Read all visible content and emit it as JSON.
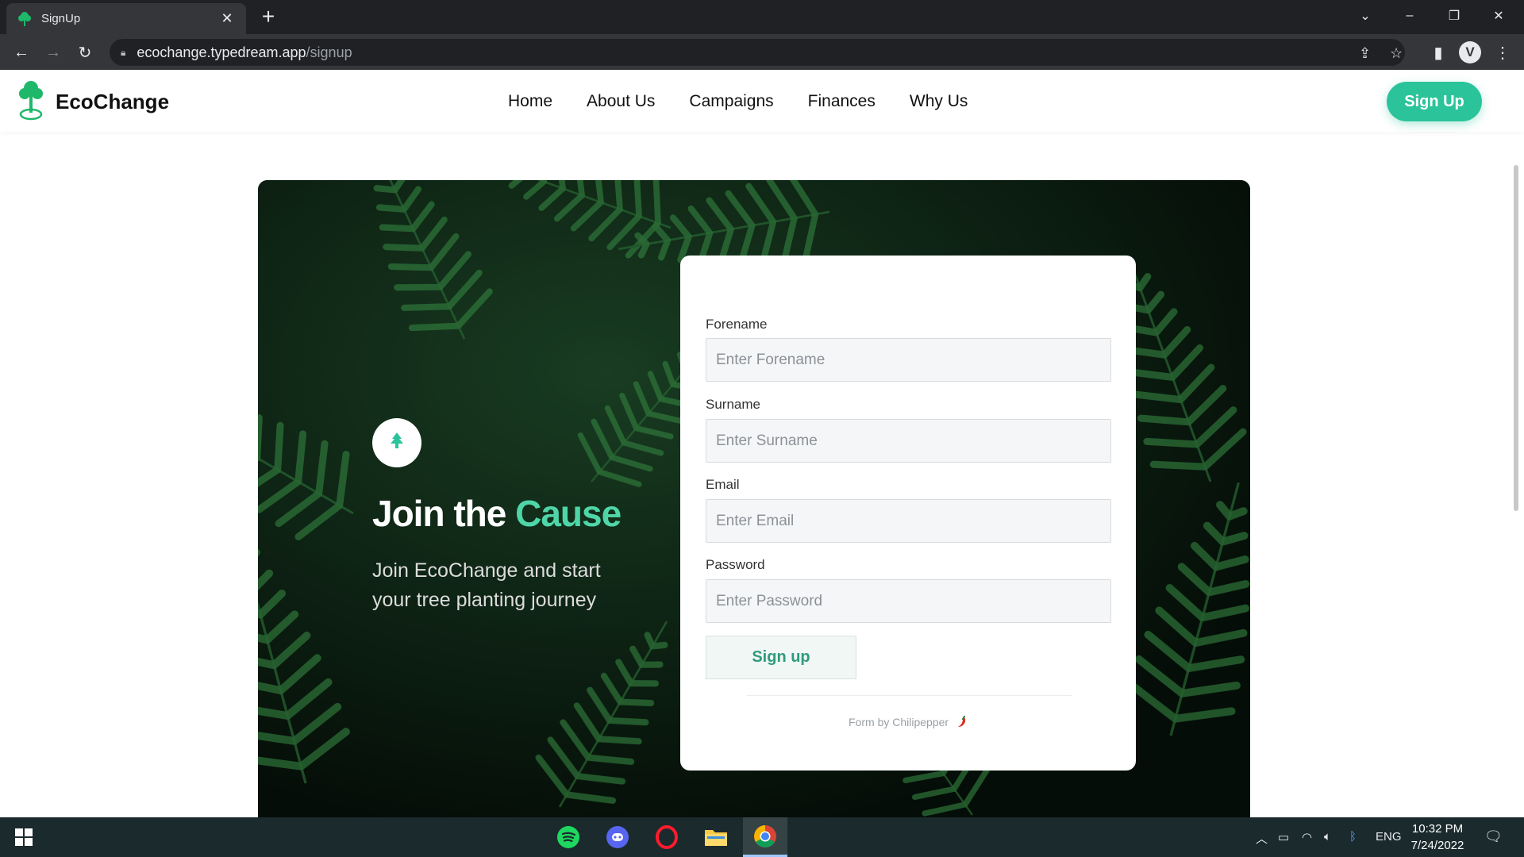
{
  "browser": {
    "tab_title": "SignUp",
    "url_host": "ecochange.typedream.app",
    "url_path": "/signup",
    "profile_initial": "V"
  },
  "site": {
    "brand": "EcoChange",
    "nav": [
      "Home",
      "About Us",
      "Campaigns",
      "Finances",
      "Why Us"
    ],
    "cta_label": "Sign Up"
  },
  "hero": {
    "headline_prefix": "Join the ",
    "headline_accent": "Cause",
    "subtitle": "Join EcoChange and start your tree planting journey"
  },
  "form": {
    "fields": [
      {
        "label": "Forename",
        "placeholder": "Enter Forename"
      },
      {
        "label": "Surname",
        "placeholder": "Enter Surname"
      },
      {
        "label": "Email",
        "placeholder": "Enter Email"
      },
      {
        "label": "Password",
        "placeholder": "Enter Password"
      }
    ],
    "submit_label": "Sign up",
    "credit": "Form by Chilipepper"
  },
  "taskbar": {
    "apps": [
      "spotify-icon",
      "discord-icon",
      "opera-icon",
      "file-explorer-icon",
      "chrome-icon"
    ],
    "language": "ENG",
    "time": "10:32 PM",
    "date": "7/24/2022"
  },
  "colors": {
    "accent": "#2bc49a",
    "accent_light": "#4fd6a8",
    "browser_dark": "#202124",
    "taskbar": "#1b2a2c"
  }
}
